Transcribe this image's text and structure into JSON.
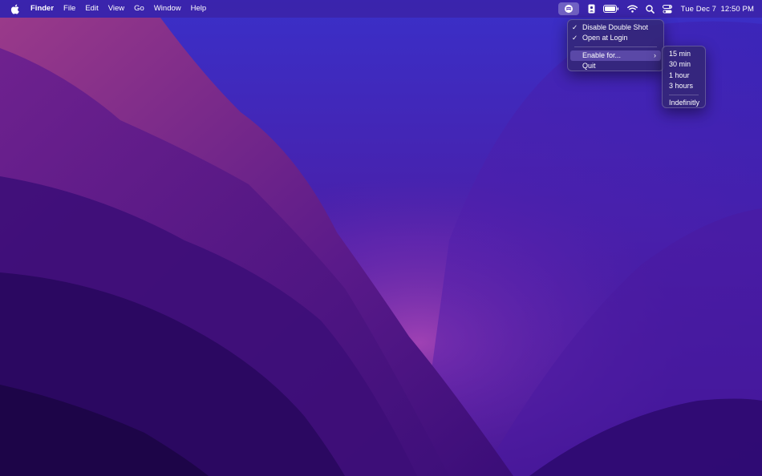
{
  "menubar": {
    "app_name": "Finder",
    "menus": [
      "File",
      "Edit",
      "View",
      "Go",
      "Window",
      "Help"
    ],
    "clock": {
      "date": "Tue Dec 7",
      "time": "12:50 PM"
    }
  },
  "main_menu": {
    "items": [
      {
        "label": "Disable Double Shot",
        "checked": true
      },
      {
        "label": "Open at Login",
        "checked": true
      },
      {
        "label": "Enable for...",
        "submenu": true,
        "highlighted": true
      },
      {
        "label": "Quit"
      }
    ]
  },
  "sub_menu": {
    "items": [
      "15 min",
      "30 min",
      "1 hour",
      "3 hours"
    ],
    "extra": "Indefinitly"
  },
  "status_icons": [
    "double-shot-icon",
    "contact-card-icon",
    "battery-icon",
    "wifi-icon",
    "search-icon",
    "control-center-icon"
  ],
  "colors": {
    "accent_highlight": "#7a64c8",
    "menubar": "#3c198c"
  }
}
